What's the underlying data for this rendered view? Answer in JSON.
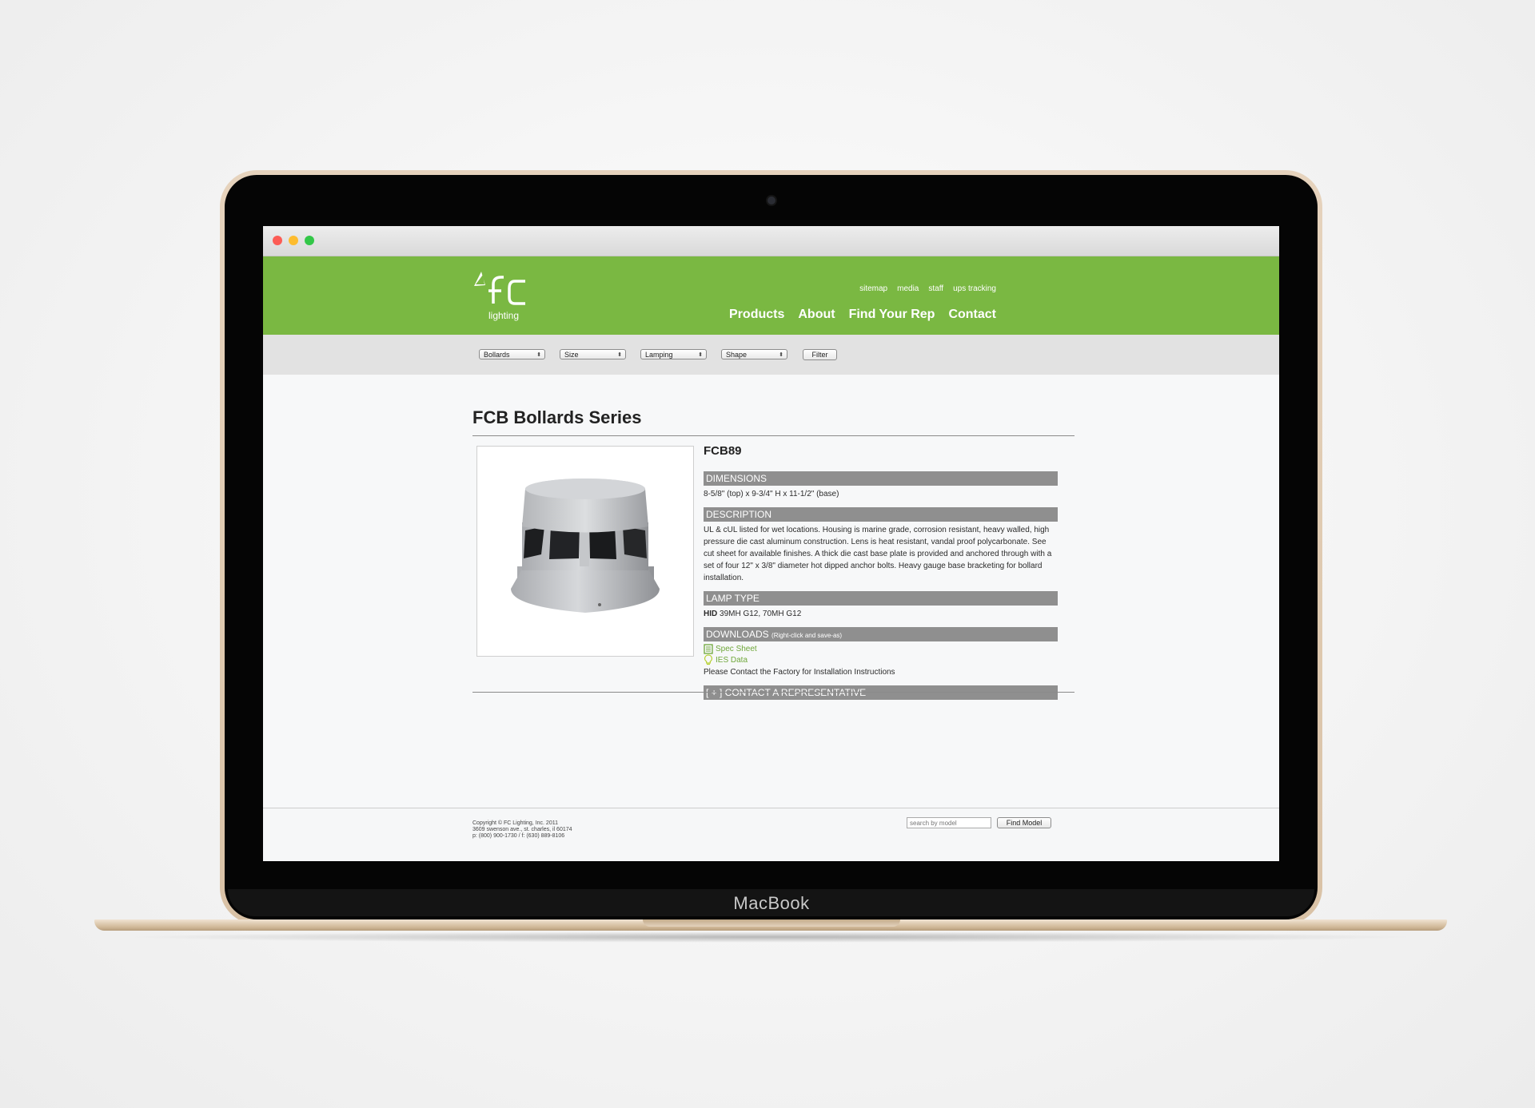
{
  "device": {
    "brand": "MacBook"
  },
  "header": {
    "logo_text": "lighting",
    "utility_links": [
      "sitemap",
      "media",
      "staff",
      "ups tracking"
    ],
    "nav": [
      "Products",
      "About",
      "Find Your Rep",
      "Contact"
    ]
  },
  "filters": {
    "selects": [
      "Bollards",
      "Size",
      "Lamping",
      "Shape"
    ],
    "filter_button": "Filter"
  },
  "product": {
    "series_title": "FCB Bollards Series",
    "model": "FCB89",
    "sections": {
      "dimensions_label": "DIMENSIONS",
      "dimensions": "8-5/8\" (top) x 9-3/4\" H x 11-1/2\" (base)",
      "description_label": "DESCRIPTION",
      "description": "UL & cUL listed for wet locations. Housing is marine grade, corrosion resistant, heavy walled, high pressure die cast aluminum construction. Lens is heat resistant, vandal proof polycarbonate. See cut sheet for available finishes. A thick die cast base plate is provided and anchored through with a set of four 12\" x 3/8\" diameter hot dipped anchor bolts. Heavy gauge base bracketing for bollard installation.",
      "lamp_type_label": "LAMP TYPE",
      "lamp_type_bold": "HID",
      "lamp_type_value": "39MH G12, 70MH G12",
      "downloads_label": "DOWNLOADS",
      "downloads_note": "(Right-click and save-as)",
      "spec_sheet": "Spec Sheet",
      "ies_data": "IES Data",
      "install_note": "Please Contact the Factory for Installation Instructions",
      "contact_rep": "[ + ] CONTACT A REPRESENTATIVE"
    }
  },
  "footer": {
    "copyright": "Copyright © FC Lighting, Inc. 2011",
    "address": "3609 swenson ave., st. charles, il 60174",
    "phone": "p: (800) 900-1730 / f: (630) 889-8106",
    "search_placeholder": "search by model",
    "find_button": "Find Model"
  },
  "colors": {
    "brand_green": "#7ab842",
    "bar_gray": "#8f8f8f",
    "laptop_gold": "#d9c2a6"
  }
}
